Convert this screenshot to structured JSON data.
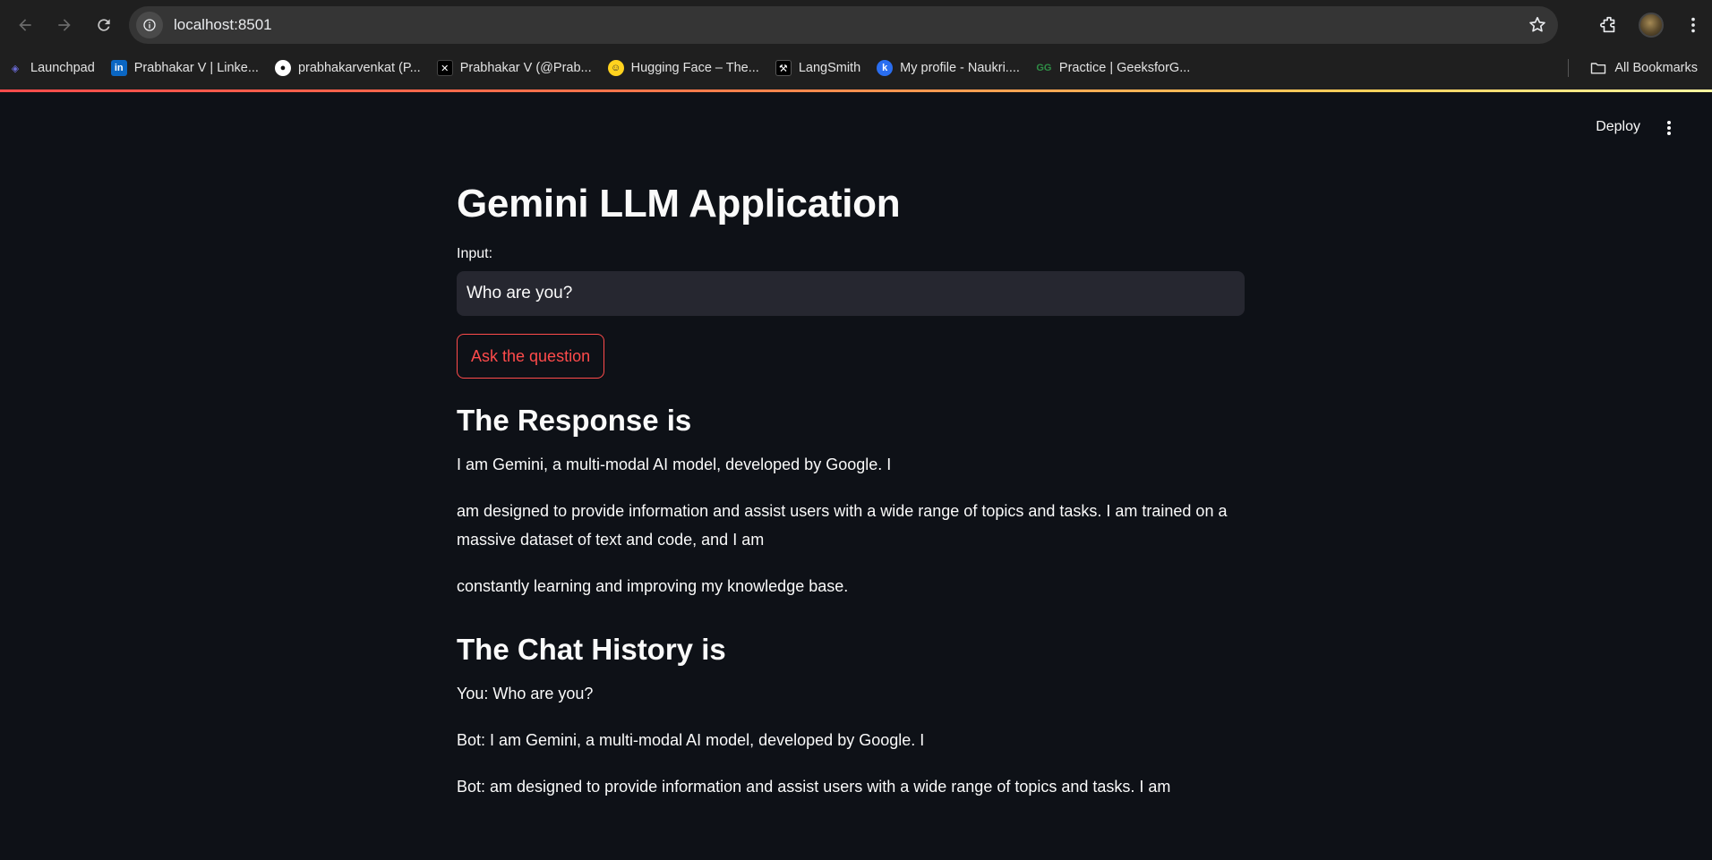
{
  "browser": {
    "url": "localhost:8501",
    "bookmarks": [
      {
        "label": "Launchpad",
        "icon": "launchpad-icon"
      },
      {
        "label": "Prabhakar V | Linke...",
        "icon": "linkedin-icon"
      },
      {
        "label": "prabhakarvenkat (P...",
        "icon": "github-icon"
      },
      {
        "label": "Prabhakar V (@Prab...",
        "icon": "x-icon"
      },
      {
        "label": "Hugging Face – The...",
        "icon": "hugging-face-icon"
      },
      {
        "label": "LangSmith",
        "icon": "langsmith-icon"
      },
      {
        "label": "My profile - Naukri....",
        "icon": "naukri-icon"
      },
      {
        "label": "Practice | GeeksforG...",
        "icon": "geeksforgeeks-icon"
      }
    ],
    "all_bookmarks": "All Bookmarks"
  },
  "app": {
    "deploy_label": "Deploy",
    "title": "Gemini LLM Application",
    "input_label": "Input:",
    "input_value": "Who are you?",
    "ask_button": "Ask the question",
    "response_heading": "The Response is",
    "response": [
      "I am Gemini, a multi-modal AI model, developed by Google. I",
      "am designed to provide information and assist users with a wide range of topics and tasks. I am trained on a massive dataset of text and code, and I am",
      "constantly learning and improving my knowledge base."
    ],
    "history_heading": "The Chat History is",
    "history": [
      "You: Who are you?",
      "Bot: I am Gemini, a multi-modal AI model, developed by Google. I",
      "Bot: am designed to provide information and assist users with a wide range of topics and tasks. I am"
    ]
  },
  "colors": {
    "background": "#0e1117",
    "input_bg": "#262730",
    "accent": "#ff4b4b",
    "chrome_bg": "#1f1f1f"
  }
}
